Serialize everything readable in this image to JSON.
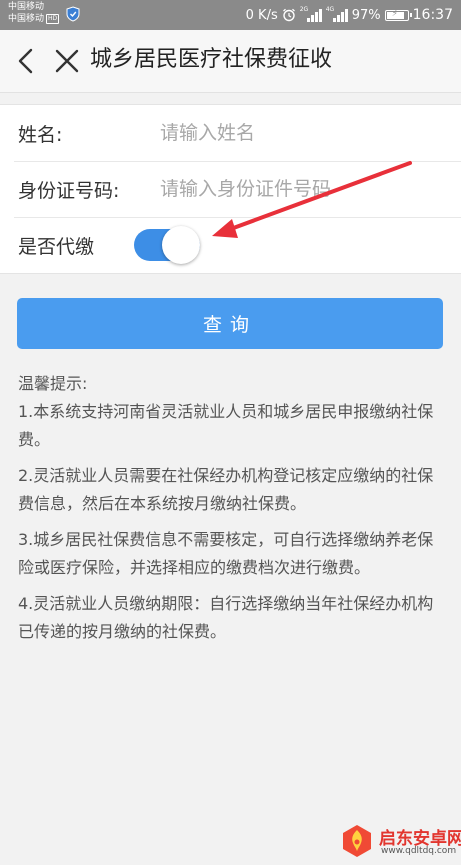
{
  "status_bar": {
    "carrier_1": "中国移动",
    "carrier_2": "中国移动",
    "hd_badge": "HD",
    "net_speed": "0 K/s",
    "sig1_tag": "2G",
    "sig2_tag": "4G",
    "battery_text": "97%",
    "battery_level": 0.97,
    "time": "16:37"
  },
  "nav": {
    "title": "城乡居民医疗社保费征收"
  },
  "form": {
    "name_label": "姓名:",
    "name_placeholder": "请输入姓名",
    "id_label": "身份证号码:",
    "id_placeholder": "请输入身份证件号码",
    "proxy_label": "是否代缴",
    "proxy_enabled": true
  },
  "query_button": "查询",
  "tips": {
    "title": "温馨提示:",
    "items": [
      "1.本系统支持河南省灵活就业人员和城乡居民申报缴纳社保费。",
      "2.灵活就业人员需要在社保经办机构登记核定应缴纳的社保费信息，然后在本系统按月缴纳社保费。",
      "3.城乡居民社保费信息不需要核定，可自行选择缴纳养老保险或医疗保险，并选择相应的缴费档次进行缴费。",
      "4.灵活就业人员缴纳期限：自行选择缴纳当年社保经办机构已传递的按月缴纳的社保费。"
    ]
  },
  "watermark": {
    "name": "启东安卓网",
    "url": "www.qdltdq.com"
  },
  "colors": {
    "accent": "#4a9cef",
    "toggle_on": "#3d8ee6",
    "annotation_arrow": "#e8303a",
    "watermark_red": "#e2362f"
  },
  "icons": {
    "back": "chevron-left-icon",
    "close": "close-icon",
    "alarm": "alarm-icon",
    "battery": "battery-icon",
    "shield": "shield-icon"
  }
}
